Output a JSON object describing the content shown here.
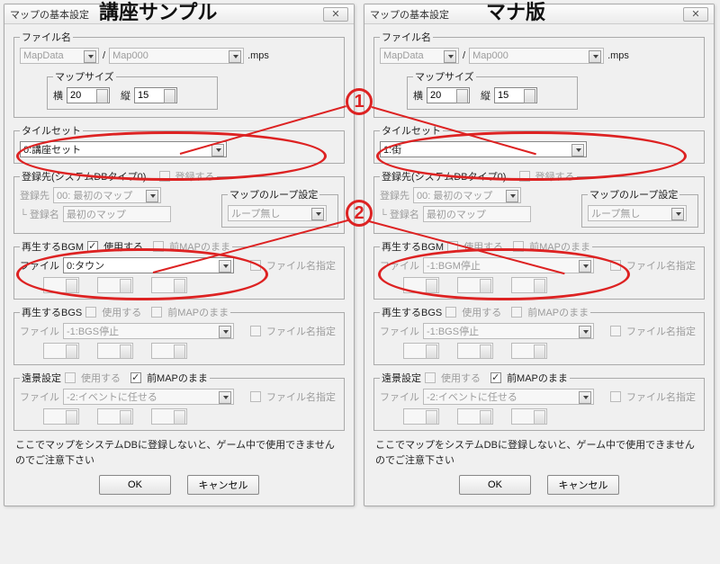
{
  "headings": {
    "left": "講座サンプル",
    "right": "マナ版"
  },
  "markers": {
    "one": "1",
    "two": "2"
  },
  "common": {
    "title": "マップの基本設定",
    "filename_group": "ファイル名",
    "mapdata": "MapData",
    "sep": "/",
    "mapfile": "Map000",
    "ext": ".mps",
    "mapsize_group": "マップサイズ",
    "width_label": "横",
    "width_value": "20",
    "height_label": "縦",
    "height_value": "15",
    "tileset_group": "タイルセット",
    "register_text": "登録先(システムDBタイプ0)",
    "register_flag": "登録する",
    "dest_label": "登録先",
    "dest_value": "00: 最初のマップ",
    "destname_label": "└ 登録名",
    "destname_value": "最初のマップ",
    "loop_group": "マップのループ設定",
    "loop_value": "ループ無し",
    "bgm_group": "再生するBGM",
    "use_label": "使用する",
    "prev_label": "前MAPのまま",
    "file_label": "ファイル",
    "filespec_label": "ファイル名指定",
    "bgs_group": "再生するBGS",
    "bgs_value": "-1:BGS停止",
    "far_group": "遠景設定",
    "far_value": "-2:イベントに任せる",
    "note": "ここでマップをシステムDBに登録しないと、ゲーム中で使用できませんのでご注意下さい",
    "ok": "OK",
    "cancel": "キャンセル"
  },
  "left": {
    "tileset_value": "0:講座セット",
    "bgm_use_checked": true,
    "bgm_value": "0:タウン"
  },
  "right": {
    "tileset_value": "1:街",
    "bgm_use_checked": false,
    "bgm_value": "-1:BGM停止"
  }
}
